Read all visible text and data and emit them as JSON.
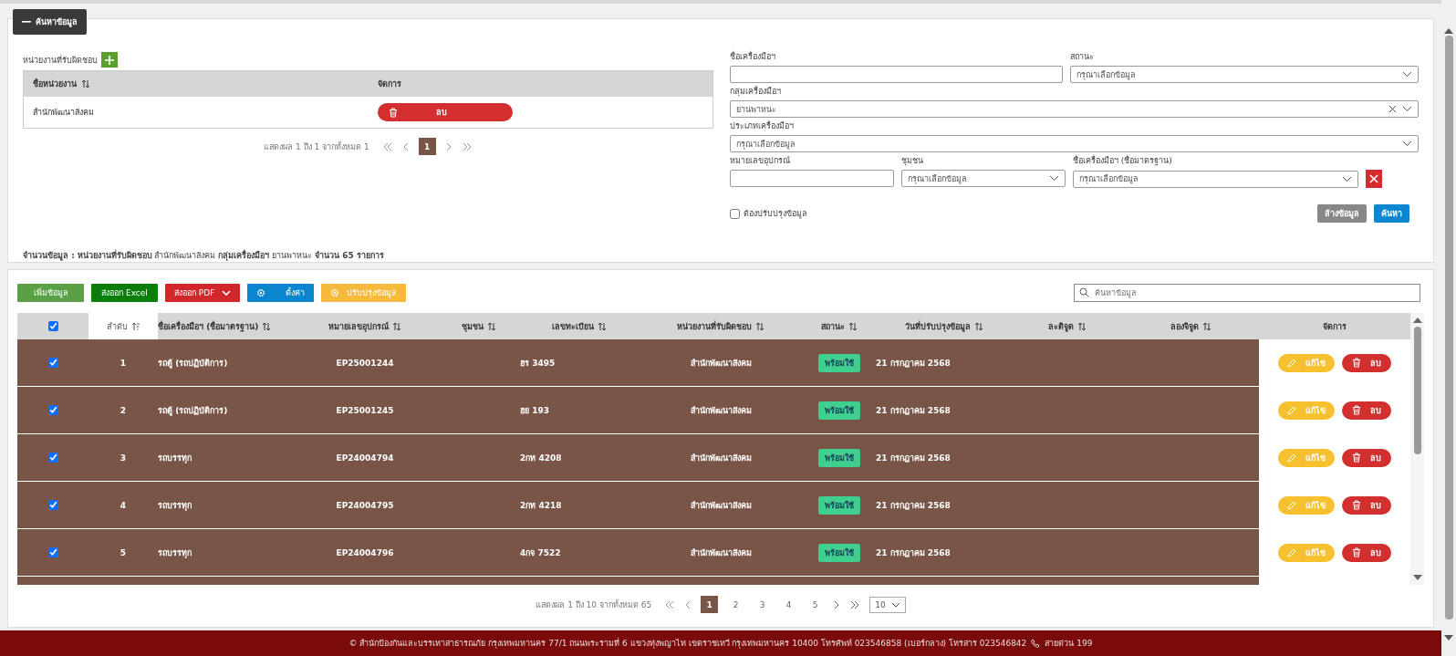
{
  "search_panel": {
    "title": "ค้นหาข้อมูล",
    "unit_table": {
      "label": "หน่วยงานที่รับผิดชอบ",
      "columns": [
        {
          "label": "ชื่อหน่วยงาน",
          "sortable": true
        },
        {
          "label": "จัดการ",
          "sortable": false
        }
      ],
      "rows": [
        {
          "name": "สำนักพัฒนาสังคม",
          "action": "ลบ"
        }
      ],
      "pagination": {
        "summary": "แสดงผล 1 ถึง 1 จากทั้งหมด 1",
        "pages": [
          {
            "label": "1",
            "selected": true
          }
        ]
      }
    },
    "filter_rows": [
      [
        {
          "kind": "text",
          "label": "ชื่อเครื่องมือฯ"
        },
        {
          "kind": "select",
          "label": "สถานะ",
          "placeholder": "กรุณาเลือกข้อมูล"
        }
      ],
      [
        {
          "kind": "select",
          "label": "กลุ่มเครื่องมือฯ",
          "value": "ยานพาหนะ",
          "clearable": true
        }
      ],
      [
        {
          "kind": "select",
          "label": "ประเภทเครื่องมือฯ",
          "placeholder": "กรุณาเลือกข้อมูล"
        }
      ],
      [
        {
          "kind": "text",
          "label": "หมายเลขอุปกรณ์"
        },
        {
          "kind": "select",
          "label": "ชุมชน",
          "placeholder": "กรุณาเลือกข้อมูล"
        },
        {
          "kind": "select",
          "label": "ชื่อเครื่องมือฯ (ชื่อมาตรฐาน)",
          "placeholder": "กรุณาเลือกข้อมูล",
          "removable": true
        }
      ]
    ],
    "needs_update": {
      "label": "ต้องปรับปรุงข้อมูล",
      "checked": false
    },
    "buttons": [
      {
        "kind": "clear",
        "label": "ล้างข้อมูล"
      },
      {
        "kind": "search",
        "label": "ค้นหา"
      }
    ],
    "summary": "**จำนวนข้อมูล :**  **หน่วยงานที่รับผิดชอบ** สำนักพัฒนาสังคม  **กลุ่มเครื่องมือฯ** ยานพาหนะ   **จำนวน 65 รายการ**"
  },
  "toolbar": [
    {
      "kind": "add",
      "label": "เพิ่มข้อมูล"
    },
    {
      "kind": "excel",
      "label": "ส่งออก Excel"
    },
    {
      "kind": "pdf",
      "label": "ส่งออก PDF"
    },
    {
      "kind": "settings",
      "label": "ตั้งค่า"
    },
    {
      "kind": "update",
      "label": "ปรับปรุงข้อมูล"
    }
  ],
  "search": {
    "placeholder": "ค้นหาข้อมูล"
  },
  "table": {
    "all_checked": true,
    "columns": [
      {
        "label": "ลำดับ",
        "selected": true
      },
      {
        "label": "ชื่อเครื่องมือฯ (ชื่อมาตรฐาน)",
        "selected": false
      },
      {
        "label": "หมายเลขอุปกรณ์",
        "selected": false
      },
      {
        "label": "ชุมชน",
        "selected": false
      },
      {
        "label": "เลขทะเบียน",
        "selected": false
      },
      {
        "label": "หน่วยงานที่รับผิดชอบ",
        "selected": false
      },
      {
        "label": "สถานะ",
        "selected": false
      },
      {
        "label": "วันที่ปรับปรุงข้อมูล",
        "selected": false
      },
      {
        "label": "ละติจูด",
        "selected": false
      },
      {
        "label": "ลองจิจูด",
        "selected": false
      },
      {
        "label": "จัดการ",
        "selected": false
      }
    ],
    "rows": [
      {
        "checked": true,
        "index": "1",
        "name": "รถตู้ (รถปฏิบัติการ)",
        "device_no": "EP25001244",
        "plate": "ฮร 3495",
        "unit": "สำนักพัฒนาสังคม",
        "status": "พร้อมใช้",
        "updated": "21 กรกฎาคม 2568",
        "edit": "แก้ไข",
        "delete": "ลบ"
      },
      {
        "checked": true,
        "index": "2",
        "name": "รถตู้ (รถปฏิบัติการ)",
        "device_no": "EP25001245",
        "plate": "ฮย 193",
        "unit": "สำนักพัฒนาสังคม",
        "status": "พร้อมใช้",
        "updated": "21 กรกฎาคม 2568",
        "edit": "แก้ไข",
        "delete": "ลบ"
      },
      {
        "checked": true,
        "index": "3",
        "name": "รถบรรทุก",
        "device_no": "EP24004794",
        "plate": "2กท 4208",
        "unit": "สำนักพัฒนาสังคม",
        "status": "พร้อมใช้",
        "updated": "21 กรกฎาคม 2568",
        "edit": "แก้ไข",
        "delete": "ลบ"
      },
      {
        "checked": true,
        "index": "4",
        "name": "รถบรรทุก",
        "device_no": "EP24004795",
        "plate": "2กท 4218",
        "unit": "สำนักพัฒนาสังคม",
        "status": "พร้อมใช้",
        "updated": "21 กรกฎาคม 2568",
        "edit": "แก้ไข",
        "delete": "ลบ"
      },
      {
        "checked": true,
        "index": "5",
        "name": "รถบรรทุก",
        "device_no": "EP24004796",
        "plate": "4กจ 7522",
        "unit": "สำนักพัฒนาสังคม",
        "status": "พร้อมใช้",
        "updated": "21 กรกฎาคม 2568",
        "edit": "แก้ไข",
        "delete": "ลบ"
      }
    ]
  },
  "pagination": {
    "summary": "แสดงผล 1 ถึง 10 จากทั้งหมด 65",
    "pages": [
      {
        "label": "1",
        "selected": true
      },
      {
        "label": "2",
        "selected": false
      },
      {
        "label": "3",
        "selected": false
      },
      {
        "label": "4",
        "selected": false
      },
      {
        "label": "5",
        "selected": false
      }
    ],
    "per_page": "10"
  },
  "footer": {
    "text": "© สำนักป้องกันและบรรเทาสาธารณภัย กรุงเทพมหานคร 77/1 ถนนพระรามที่ 6 แขวงทุ่งพญาไท เขตราชเทวี กรุงเทพมหานคร 10400 โทรศัพท์ 023546858 (เบอร์กลาง) โทรสาร 023546842",
    "hotline": "สายด่วน 199"
  }
}
